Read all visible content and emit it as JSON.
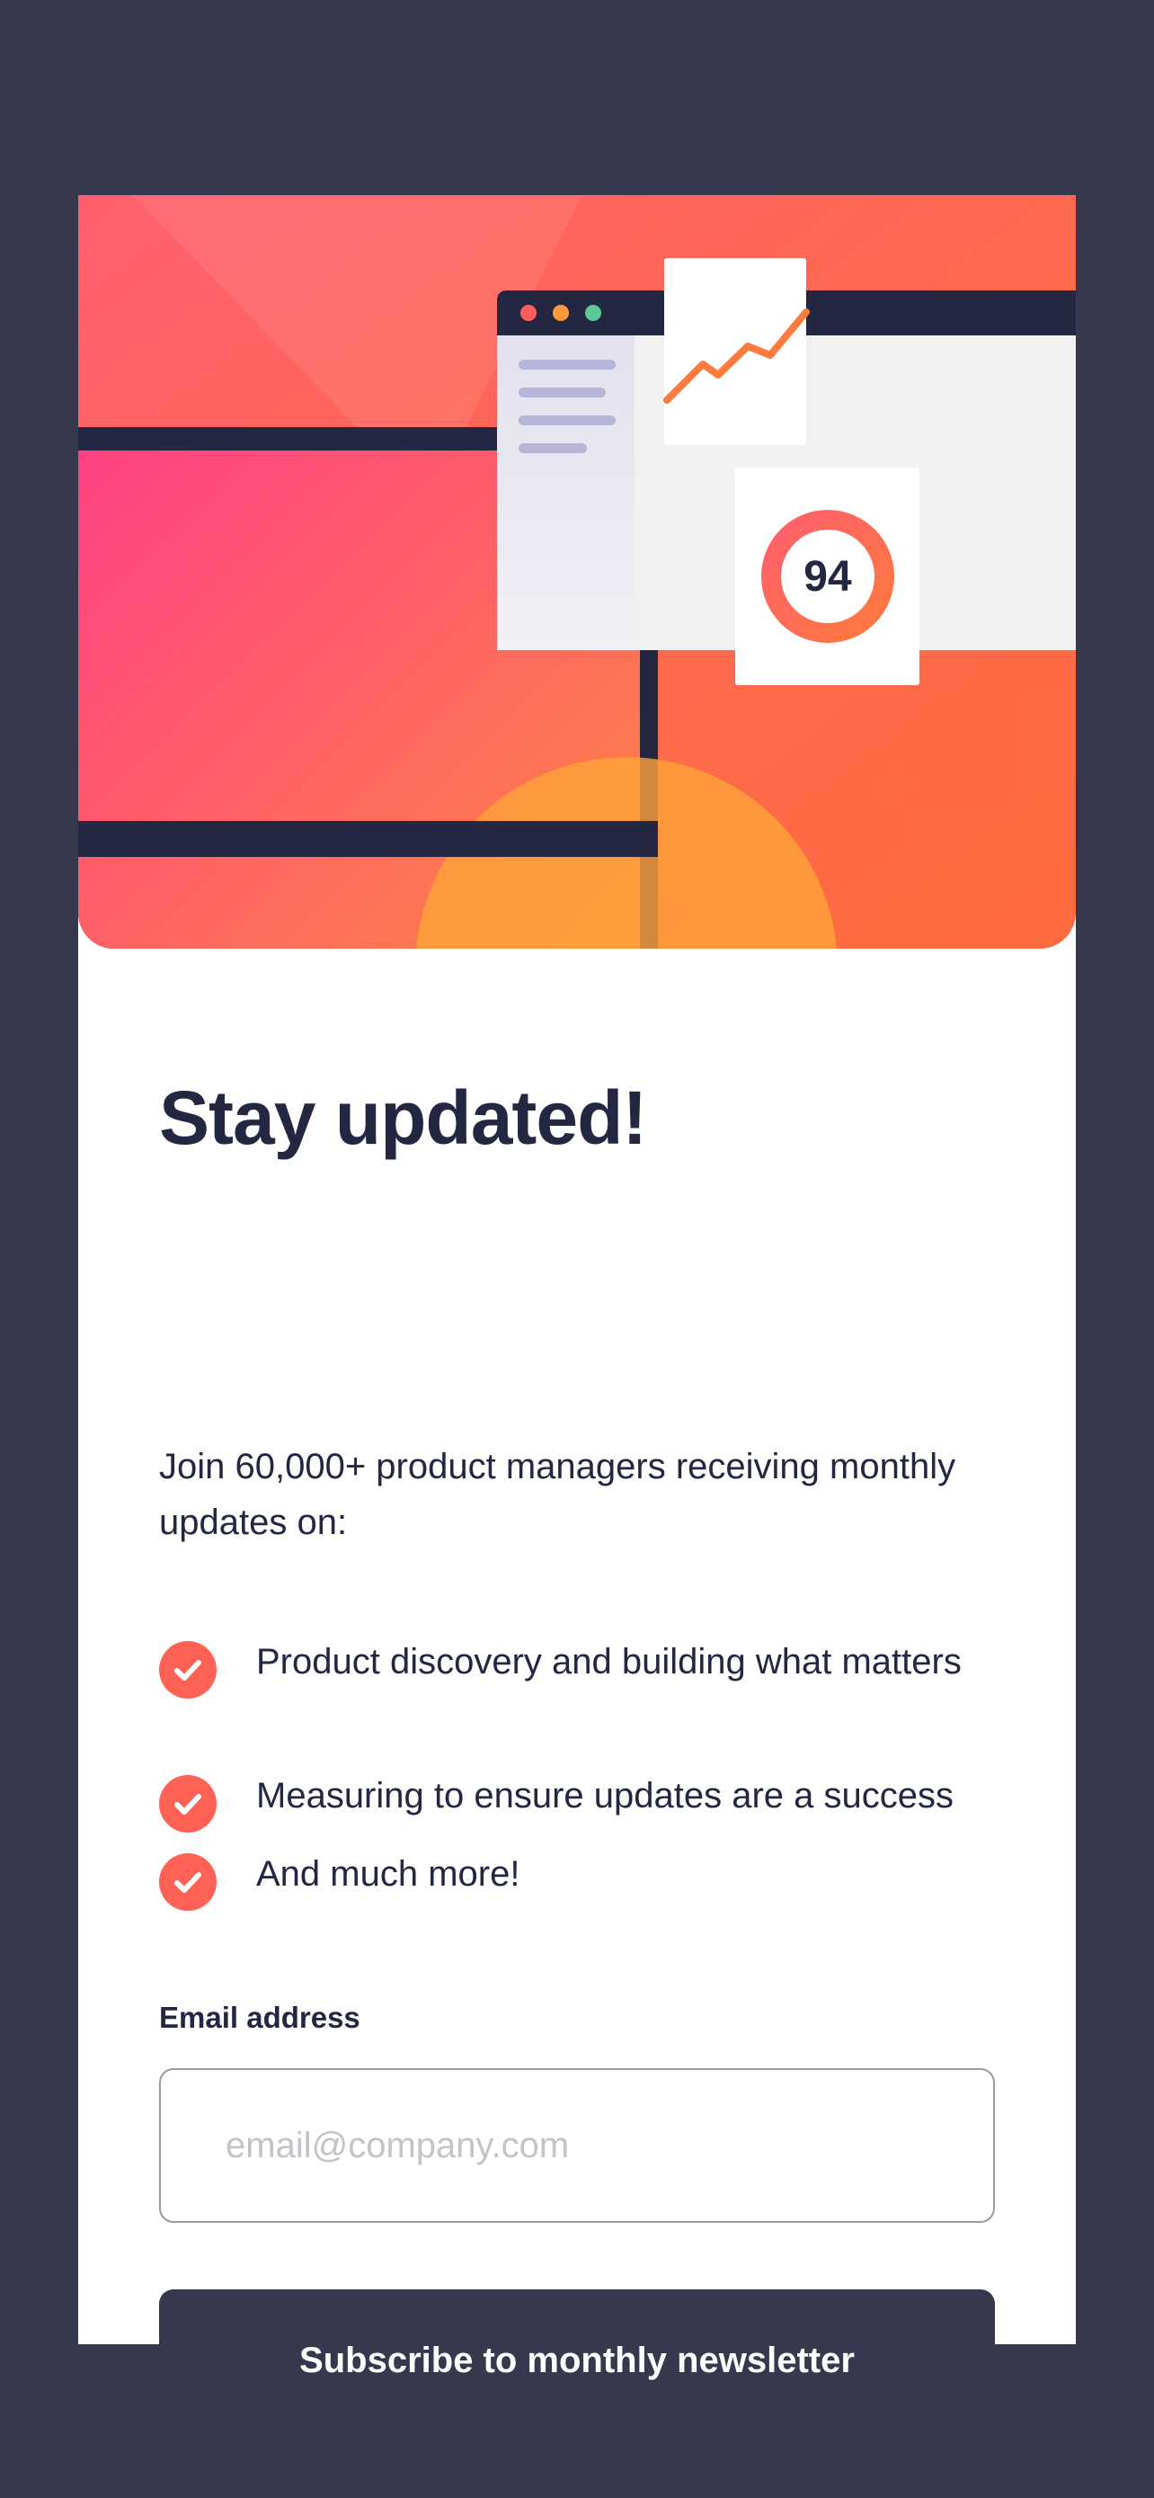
{
  "hero": {
    "score": "94"
  },
  "content": {
    "title": "Stay updated!",
    "intro": "Join 60,000+ product managers receiving monthly updates on:",
    "features": [
      "Product discovery and building what matters",
      "Measuring to ensure updates are a success",
      "And much more!"
    ]
  },
  "form": {
    "email_label": "Email address",
    "email_placeholder": "email@company.com",
    "email_value": "",
    "submit_label": "Subscribe to monthly newsletter"
  },
  "colors": {
    "page_background": "#36384d",
    "card_background": "#ffffff",
    "accent_tomato": "#ff6155",
    "text_dark_navy": "#242742",
    "button_charcoal": "#36384d"
  },
  "icons": {
    "feature_bullet": "checkmark-circle-icon",
    "hero": "analytics-dashboard-illustration"
  }
}
